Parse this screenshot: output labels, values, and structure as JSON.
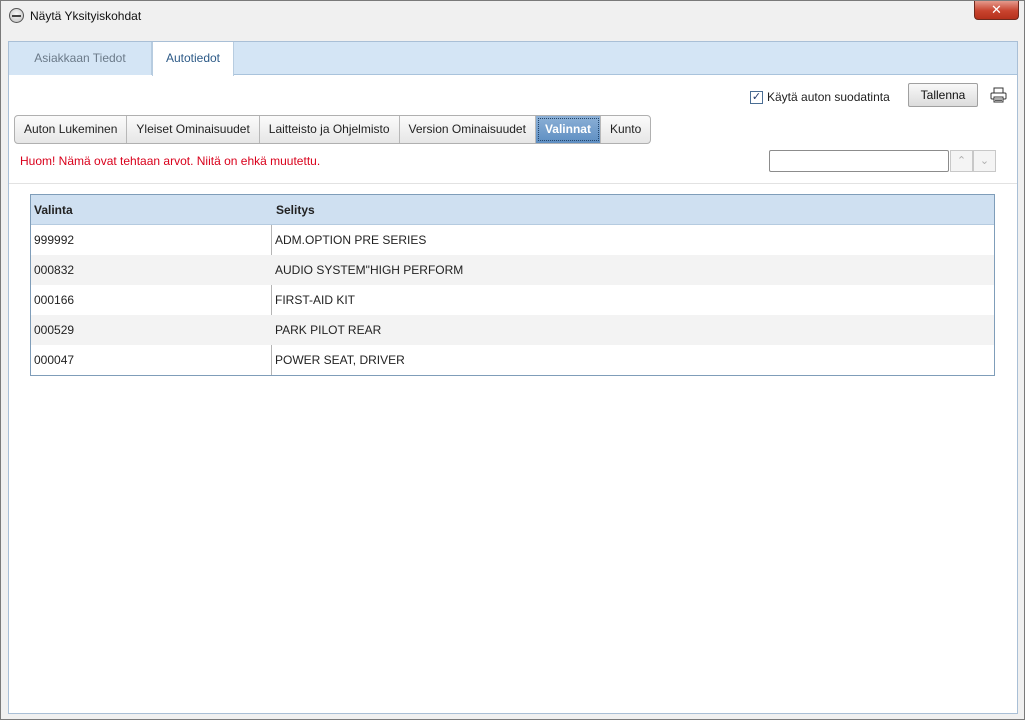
{
  "window": {
    "title": "Näytä Yksityiskohdat",
    "close_label": "✕"
  },
  "main_tabs": [
    {
      "label": "Asiakkaan Tiedot",
      "active": false
    },
    {
      "label": "Autotiedot",
      "active": true
    }
  ],
  "filter": {
    "checkbox_checked": true,
    "checkbox_label": "Käytä auton suodatinta",
    "save_label": "Tallenna"
  },
  "sub_tabs": [
    {
      "label": "Auton Lukeminen",
      "active": false
    },
    {
      "label": "Yleiset Ominaisuudet",
      "active": false
    },
    {
      "label": "Laitteisto ja Ohjelmisto",
      "active": false
    },
    {
      "label": "Version Ominaisuudet",
      "active": false
    },
    {
      "label": "Valinnat",
      "active": true
    },
    {
      "label": "Kunto",
      "active": false
    }
  ],
  "warning_text": "Huom! Nämä ovat tehtaan arvot. Niitä on ehkä muutettu.",
  "search": {
    "value": "",
    "up_glyph": "⌃",
    "down_glyph": "⌄"
  },
  "grid": {
    "columns": [
      "Valinta",
      "Selitys"
    ],
    "rows": [
      [
        "999992",
        "ADM.OPTION PRE SERIES"
      ],
      [
        "000832",
        "AUDIO SYSTEM\"HIGH PERFORM"
      ],
      [
        "000166",
        "FIRST-AID KIT"
      ],
      [
        "000529",
        "PARK PILOT REAR"
      ],
      [
        "000047",
        "POWER SEAT, DRIVER"
      ]
    ]
  },
  "colors": {
    "tab_strip": "#d4e5f5",
    "active_subtab": "#5d8ec2",
    "warning": "#d9001b",
    "grid_header": "#cfe0f1"
  }
}
